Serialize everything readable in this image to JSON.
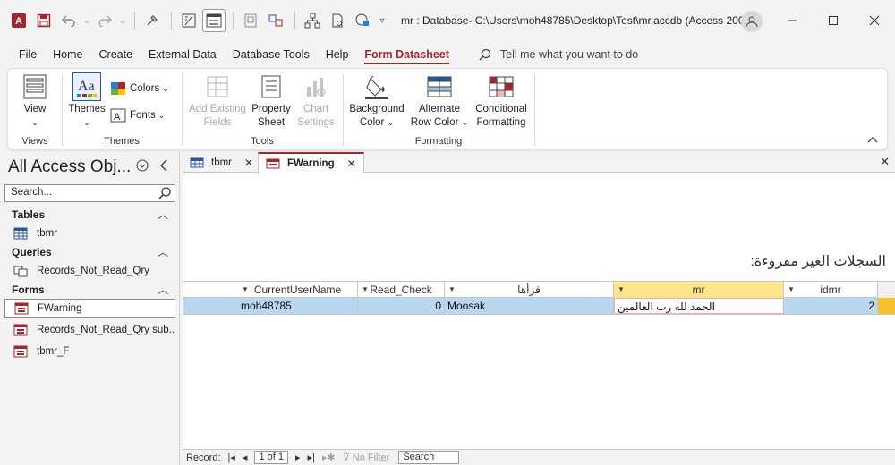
{
  "titlebar": {
    "title": "mr : Database- C:\\Users\\moh48785\\Desktop\\Test\\mr.accdb (Access 200...",
    "quick_access_overflow": "▿"
  },
  "menu": {
    "tabs": [
      "File",
      "Home",
      "Create",
      "External Data",
      "Database Tools",
      "Help",
      "Form Datasheet"
    ],
    "active_tab": "Form Datasheet",
    "tell_me": "Tell me what you want to do"
  },
  "ribbon": {
    "views_group": "Views",
    "view_label": "View",
    "themes_group": "Themes",
    "themes_label": "Themes",
    "colors_label": "Colors",
    "fonts_label": "Fonts",
    "tools_group": "Tools",
    "add_existing_fields": [
      "Add Existing",
      "Fields"
    ],
    "property_sheet": [
      "Property",
      "Sheet"
    ],
    "chart_settings": [
      "Chart",
      "Settings"
    ],
    "formatting_group": "Formatting",
    "background_color": [
      "Background",
      "Color"
    ],
    "alternate_row_color": [
      "Alternate",
      "Row Color"
    ],
    "conditional_formatting": [
      "Conditional",
      "Formatting"
    ]
  },
  "nav": {
    "title": "All Access Obj...",
    "search_placeholder": "Search...",
    "sections": {
      "tables": "Tables",
      "queries": "Queries",
      "forms": "Forms"
    },
    "items": {
      "tbmr": "tbmr",
      "records_qry": "Records_Not_Read_Qry",
      "fwarning": "FWarning",
      "records_qry_sub": "Records_Not_Read_Qry sub...",
      "tbmr_f": "tbmr_F"
    }
  },
  "doc": {
    "tabs": [
      {
        "label": "tbmr"
      },
      {
        "label": "FWarning"
      }
    ],
    "form_label": "السجلات الغير مقروءة:",
    "columns": [
      "CurrentUserName",
      "Read_Check",
      "قرأها",
      "mr",
      "idmr"
    ],
    "row": [
      "moh48785",
      "0",
      "Moosak",
      "الحمد لله رب العالمين",
      "2"
    ]
  },
  "record_nav": {
    "record_label": "Record:",
    "position": "1 of 1",
    "no_filter": "No Filter",
    "search": "Search"
  },
  "colors": {
    "accent": "#a4262c",
    "row_selected": "#b9d7f0",
    "active_header": "#fde58a"
  }
}
